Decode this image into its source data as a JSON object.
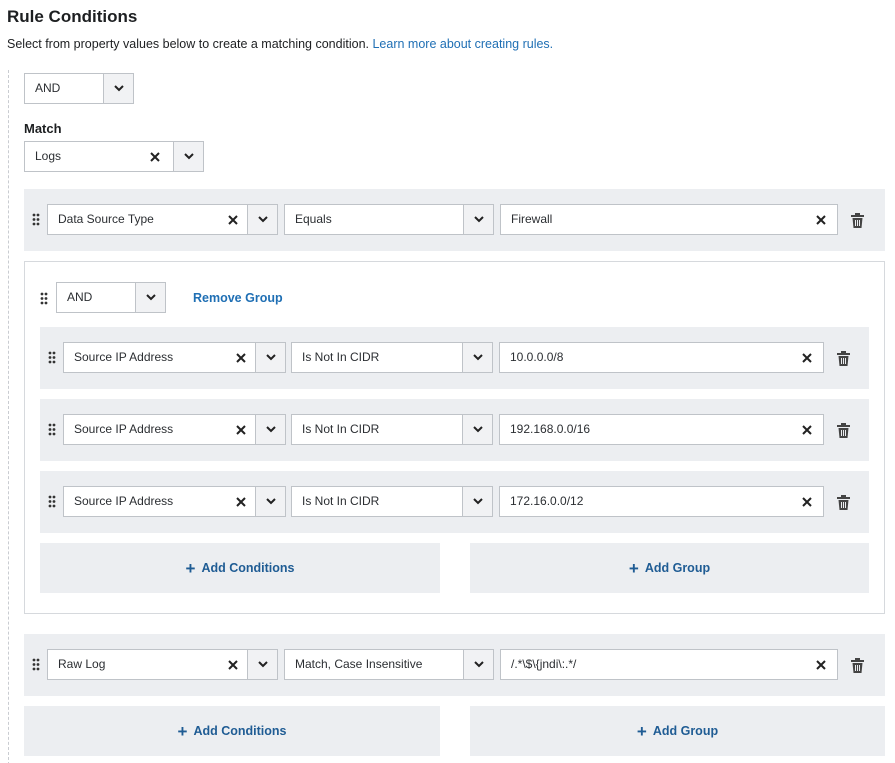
{
  "header": {
    "title": "Rule Conditions",
    "subtitle": "Select from property values below to create a matching condition.",
    "learn_more": "Learn more about creating rules."
  },
  "root": {
    "operator": "AND",
    "match_label": "Match",
    "match_value": "Logs"
  },
  "conditions": [
    {
      "property": "Data Source Type",
      "operator": "Equals",
      "value": "Firewall"
    }
  ],
  "group": {
    "operator": "AND",
    "remove_label": "Remove Group",
    "conditions": [
      {
        "property": "Source IP Address",
        "operator": "Is Not In CIDR",
        "value": "10.0.0.0/8"
      },
      {
        "property": "Source IP Address",
        "operator": "Is Not In CIDR",
        "value": "192.168.0.0/16"
      },
      {
        "property": "Source IP Address",
        "operator": "Is Not In CIDR",
        "value": "172.16.0.0/12"
      }
    ],
    "add_conditions_label": "Add Conditions",
    "add_group_label": "Add Group"
  },
  "after_group": [
    {
      "property": "Raw Log",
      "operator": "Match, Case Insensitive",
      "value": "/.*\\$\\{jndi\\:.*/"
    }
  ],
  "footer": {
    "add_conditions_label": "Add Conditions",
    "add_group_label": "Add Group"
  },
  "icons": {
    "drag": "drag-handle-icon",
    "clear": "close-icon",
    "caret": "chevron-down-icon",
    "delete": "trash-icon",
    "add": "plus-icon"
  },
  "colors": {
    "link": "#1f6fb4",
    "button_text": "#1f5c94",
    "row_bg": "#eceef1"
  }
}
